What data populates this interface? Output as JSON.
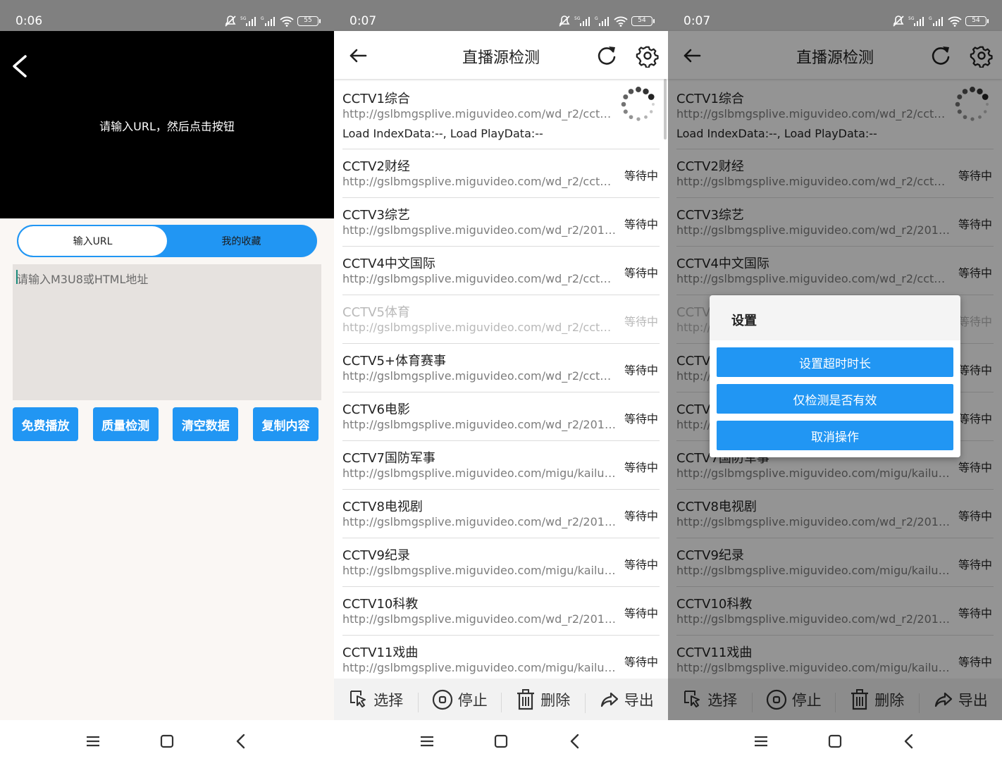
{
  "colors": {
    "accent": "#2196f3",
    "statusbar": "#808080"
  },
  "screen1": {
    "time": "0:06",
    "battery": "55",
    "player_hint": "请输入URL，然后点击按钮",
    "tabs": [
      {
        "label": "输入URL",
        "active": true
      },
      {
        "label": "我的收藏",
        "active": false
      }
    ],
    "url_placeholder": "请输入M3U8或HTML地址",
    "buttons": [
      "免费播放",
      "质量检测",
      "清空数据",
      "复制内容"
    ]
  },
  "screen2": {
    "time": "0:07",
    "battery": "54",
    "title": "直播源检测",
    "rows": [
      {
        "name": "CCTV1综合",
        "url": "http://gslbmgsplive.miguvideo.com/wd_r2/cctv1…",
        "load": "Load IndexData:--, Load PlayData:--",
        "state": "",
        "loading": true,
        "dim": false
      },
      {
        "name": "CCTV2财经",
        "url": "http://gslbmgsplive.miguvideo.com/wd_r2/cctv2…",
        "state": "等待中",
        "dim": false
      },
      {
        "name": "CCTV3综艺",
        "url": "http://gslbmgsplive.miguvideo.com/wd_r2/2018…",
        "state": "等待中",
        "dim": false
      },
      {
        "name": "CCTV4中文国际",
        "url": "http://gslbmgsplive.miguvideo.com/wd_r2/cctv4…",
        "state": "等待中",
        "dim": false
      },
      {
        "name": "CCTV5体育",
        "url": "http://gslbmgsplive.miguvideo.com/wd_r2/cctv5…",
        "state": "等待中",
        "dim": true
      },
      {
        "name": "CCTV5+体育赛事",
        "url": "http://gslbmgsplive.miguvideo.com/wd_r2/cctv5p…",
        "state": "等待中",
        "dim": false
      },
      {
        "name": "CCTV6电影",
        "url": "http://gslbmgsplive.miguvideo.com/wd_r2/2018…",
        "state": "等待中",
        "dim": false
      },
      {
        "name": "CCTV7国防军事",
        "url": "http://gslbmgsplive.miguvideo.com/migu/kailu…",
        "state": "等待中",
        "dim": false
      },
      {
        "name": "CCTV8电视剧",
        "url": "http://gslbmgsplive.miguvideo.com/wd_r2/2018…",
        "state": "等待中",
        "dim": false
      },
      {
        "name": "CCTV9纪录",
        "url": "http://gslbmgsplive.miguvideo.com/migu/kailu…",
        "state": "等待中",
        "dim": false
      },
      {
        "name": "CCTV10科教",
        "url": "http://gslbmgsplive.miguvideo.com/wd_r2/2018…",
        "state": "等待中",
        "dim": false
      },
      {
        "name": "CCTV11戏曲",
        "url": "http://gslbmgsplive.miguvideo.com/migu/kailu…",
        "state": "等待中",
        "dim": false
      }
    ],
    "bottom": [
      "选择",
      "停止",
      "删除",
      "导出"
    ]
  },
  "screen3": {
    "time": "0:07",
    "battery": "54",
    "dialog": {
      "title": "设置",
      "options": [
        "设置超时时长",
        "仅检测是否有效",
        "取消操作"
      ]
    }
  }
}
